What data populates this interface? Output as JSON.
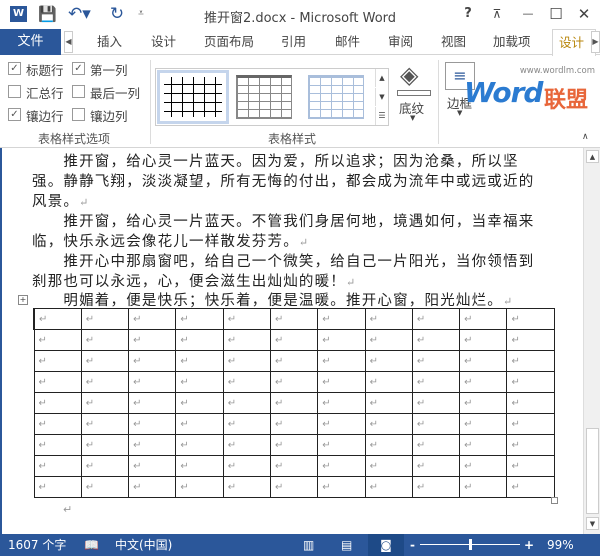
{
  "titlebar": {
    "title": "推开窗2.docx - Microsoft Word",
    "icons": [
      "word-app-icon",
      "save-icon",
      "undo-icon",
      "redo-icon",
      "customize-icon",
      "help-icon",
      "ribbon-display-icon",
      "minimize-icon",
      "maximize-icon",
      "close-icon"
    ],
    "help": "?",
    "minimize": "—",
    "maximize": "☐",
    "close": "✕"
  },
  "tabs": {
    "file": "文件",
    "items": [
      "插入",
      "设计",
      "页面布局",
      "引用",
      "邮件",
      "审阅",
      "视图",
      "加载项"
    ],
    "active": "设计"
  },
  "ribbon": {
    "options": {
      "label": "表格样式选项",
      "checkboxes": [
        {
          "label": "标题行",
          "checked": true
        },
        {
          "label": "第一列",
          "checked": true
        },
        {
          "label": "汇总行",
          "checked": false
        },
        {
          "label": "最后一列",
          "checked": false
        },
        {
          "label": "镶边行",
          "checked": true
        },
        {
          "label": "镶边列",
          "checked": false
        }
      ]
    },
    "styles": {
      "label": "表格样式"
    },
    "shading": "底纹",
    "borders": "边框",
    "logo": {
      "url": "www.wordlm.com",
      "word": "Word",
      "cn": "联盟"
    }
  },
  "document": {
    "lines": [
      "　　推开窗，给心灵一片蓝天。因为爱，所以追求；因为沧桑，所以坚",
      "强。静静飞翔，淡淡凝望，所有无悔的付出，都会成为流年中或远或近的",
      "风景。",
      "　　推开窗，给心灵一片蓝天。不管我们身居何地，境遇如何，当幸福来",
      "临，快乐永远会像花儿一样散发芬芳。",
      "　　推开心中那扇窗吧，给自己一个微笑，给自己一片阳光，当你领悟到",
      "刹那也可以永远，心，便会滋生出灿灿的暖！",
      "　　明媚着，便是快乐；快乐着，便是温暖。推开心窗，阳光灿烂。"
    ],
    "paragraph_mark": "↵",
    "table": {
      "rows": 9,
      "cols": 11
    }
  },
  "status": {
    "word_count": "1607 个字",
    "language": "中文(中国)",
    "zoom": "99%",
    "zoom_minus": "-",
    "zoom_plus": "+",
    "zoom_level_percent": 99
  },
  "colors": {
    "accent": "#2b579a",
    "active_tab": "#b8860b"
  }
}
